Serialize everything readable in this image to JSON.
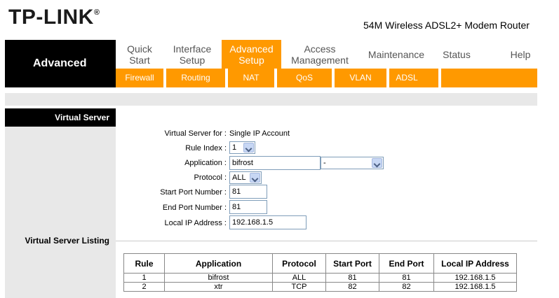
{
  "header": {
    "logo": "TP-LINK",
    "logo_mark": "®",
    "model": "54M Wireless ADSL2+ Modem Router"
  },
  "nav": {
    "section": "Advanced",
    "items": [
      {
        "line1": "Quick",
        "line2": "Start"
      },
      {
        "line1": "Interface",
        "line2": "Setup"
      },
      {
        "line1": "Advanced",
        "line2": "Setup"
      },
      {
        "line1": "Access",
        "line2": "Management"
      },
      {
        "line1": "Maintenance",
        "line2": ""
      },
      {
        "line1": "Status",
        "line2": ""
      },
      {
        "line1": "Help",
        "line2": ""
      }
    ],
    "sub": [
      "Firewall",
      "Routing",
      "NAT",
      "QoS",
      "VLAN",
      "ADSL"
    ]
  },
  "sidebar": {
    "virtual_server": "Virtual Server",
    "listing": "Virtual Server Listing"
  },
  "form": {
    "virtual_server_for_label": "Virtual Server for :",
    "virtual_server_for_value": "Single IP Account",
    "rule_index_label": "Rule Index :",
    "rule_index_value": "1",
    "application_label": "Application :",
    "application_value": "bifrost",
    "application_select": "-",
    "protocol_label": "Protocol :",
    "protocol_value": "ALL",
    "start_port_label": "Start Port Number :",
    "start_port_value": "81",
    "end_port_label": "End Port Number :",
    "end_port_value": "81",
    "local_ip_label": "Local IP Address :",
    "local_ip_value": "192.168.1.5"
  },
  "table": {
    "headers": [
      "Rule",
      "Application",
      "Protocol",
      "Start Port",
      "End Port",
      "Local IP Address"
    ],
    "rows": [
      [
        "1",
        "bifrost",
        "ALL",
        "81",
        "81",
        "192.168.1.5"
      ],
      [
        "2",
        "xtr",
        "TCP",
        "82",
        "82",
        "192.168.1.5"
      ]
    ]
  }
}
